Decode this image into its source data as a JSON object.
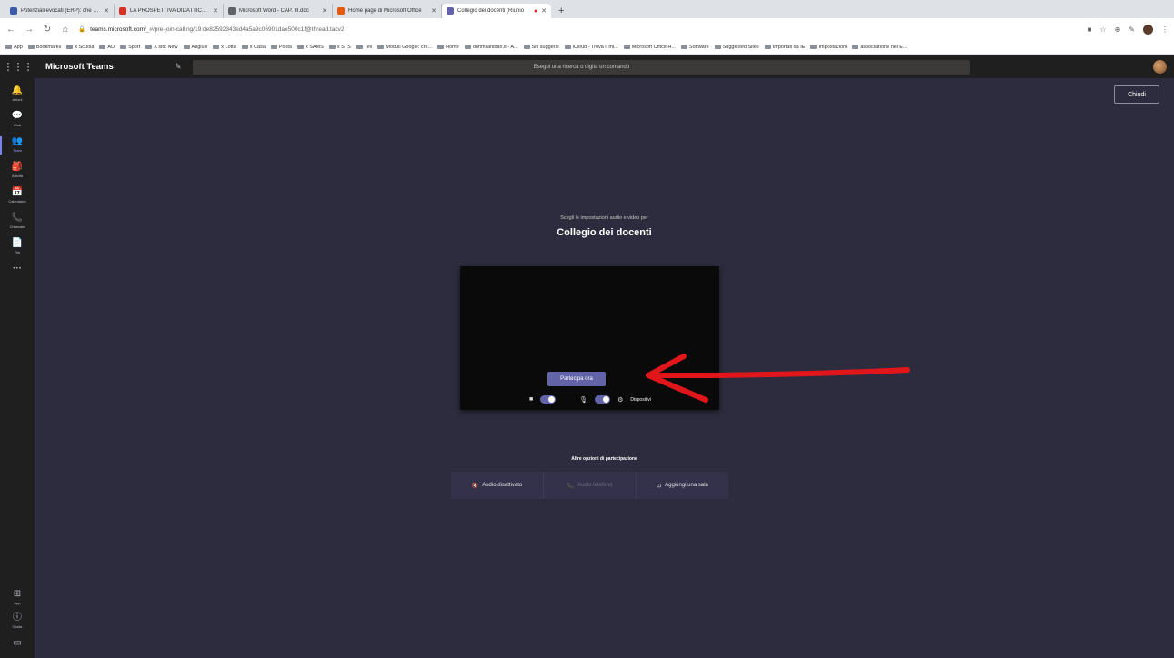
{
  "browser": {
    "tabs": [
      {
        "title": "Potenziali evocati (ERP): che co:",
        "color": "#3b5ba9"
      },
      {
        "title": "LA PROSPETTIVA DIDATTICA D",
        "color": "#d93025"
      },
      {
        "title": "Microsoft Word - CAP. III.doc",
        "color": "#5f6368"
      },
      {
        "title": "Home page di Microsoft Office",
        "color": "#e8590c"
      },
      {
        "title": "Collegio dei docenti (Riunio",
        "color": "#6264a7"
      }
    ],
    "new_tab": "+",
    "url_host": "teams.microsoft.com",
    "url_path": "/_#/pre-join-calling/19:de82592343ed4a5a9c06901dae500c1f@thread.tacv2",
    "bookmarks": [
      "App",
      "Bookmarks",
      "x Scuola",
      "AD",
      "Sport",
      "X sito New",
      "Angiulli",
      "x Lotta",
      "x Casa",
      "Posta",
      "x SAMS",
      "x STS",
      "Tex",
      "Moduli Google: cre...",
      "Home",
      "donmilanibari.it - A...",
      "Siti suggeriti",
      "iCloud - Trova il mi...",
      "Microsoft Office H...",
      "Software",
      "Suggested Sites",
      "Importati da IE",
      "Impostazioni",
      "associazione nell'E..."
    ]
  },
  "teams": {
    "app_name": "Microsoft Teams",
    "search_placeholder": "Esegui una ricerca o digita un comando",
    "rail": [
      {
        "label": "Azioni",
        "icon": "bell-icon",
        "glyph": "🔔"
      },
      {
        "label": "Chat",
        "icon": "chat-icon",
        "glyph": "💬"
      },
      {
        "label": "Team",
        "icon": "teams-icon",
        "glyph": "👥"
      },
      {
        "label": "Attività",
        "icon": "assignments-icon",
        "glyph": "🎒"
      },
      {
        "label": "Calendario",
        "icon": "calendar-icon",
        "glyph": "📅"
      },
      {
        "label": "Chiamate",
        "icon": "phone-icon",
        "glyph": "📞"
      },
      {
        "label": "File",
        "icon": "file-icon",
        "glyph": "📄"
      },
      {
        "label": "",
        "icon": "more-icon",
        "glyph": "···"
      }
    ],
    "rail_bottom": [
      {
        "label": "App",
        "icon": "apps-icon",
        "glyph": "⊞"
      },
      {
        "label": "Guida",
        "icon": "help-icon",
        "glyph": "?"
      }
    ]
  },
  "prejoin": {
    "close_label": "Chiudi",
    "subtitle": "Scegli le impostazioni audio e video per",
    "meeting_title": "Collegio dei docenti",
    "join_label": "Partecipa ora",
    "devices_label": "Dispositivi",
    "other_options_title": "Altre opzioni di partecipazione",
    "options": [
      {
        "label": "Audio disattivato",
        "enabled": true
      },
      {
        "label": "Audio telefono",
        "enabled": false
      },
      {
        "label": "Aggiungi una sala",
        "enabled": true
      }
    ]
  },
  "colors": {
    "accent": "#6264a7",
    "annotation": "#e0161b"
  }
}
